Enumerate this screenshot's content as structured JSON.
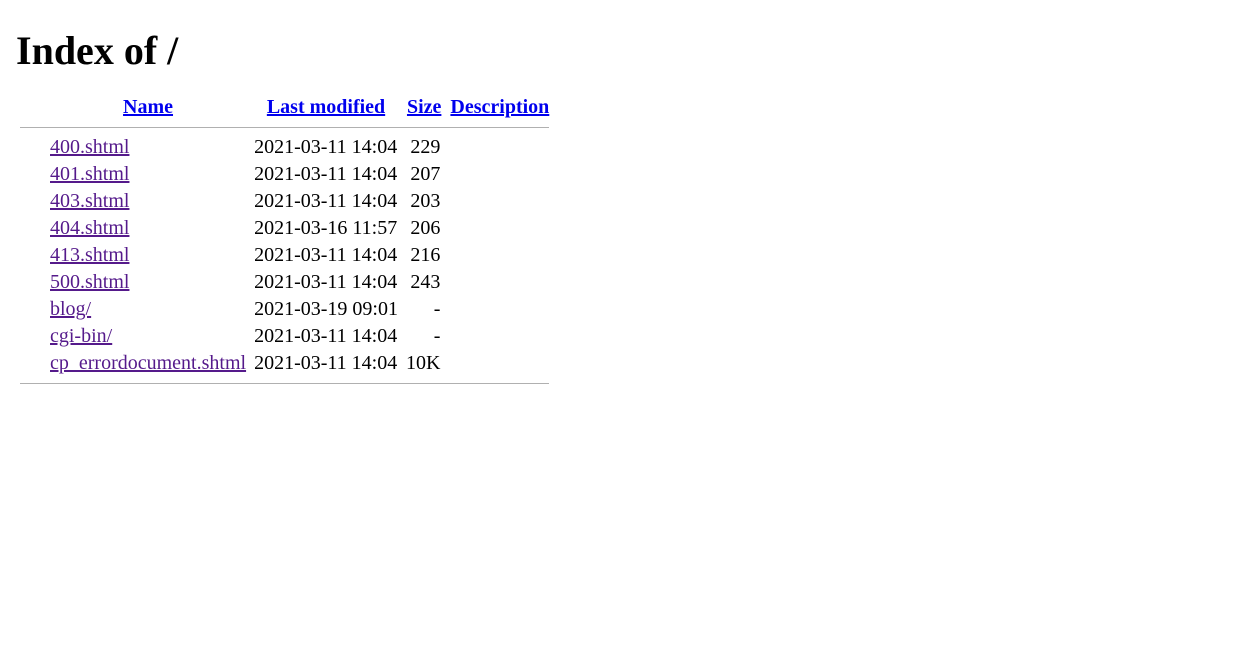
{
  "title": "Index of /",
  "columns": {
    "name": "Name",
    "modified": "Last modified",
    "size": "Size",
    "description": "Description"
  },
  "rows": [
    {
      "name": "400.shtml",
      "modified": "2021-03-11 14:04",
      "size": "229",
      "description": ""
    },
    {
      "name": "401.shtml",
      "modified": "2021-03-11 14:04",
      "size": "207",
      "description": ""
    },
    {
      "name": "403.shtml",
      "modified": "2021-03-11 14:04",
      "size": "203",
      "description": ""
    },
    {
      "name": "404.shtml",
      "modified": "2021-03-16 11:57",
      "size": "206",
      "description": ""
    },
    {
      "name": "413.shtml",
      "modified": "2021-03-11 14:04",
      "size": "216",
      "description": ""
    },
    {
      "name": "500.shtml",
      "modified": "2021-03-11 14:04",
      "size": "243",
      "description": ""
    },
    {
      "name": "blog/",
      "modified": "2021-03-19 09:01",
      "size": "-",
      "description": ""
    },
    {
      "name": "cgi-bin/",
      "modified": "2021-03-11 14:04",
      "size": "-",
      "description": ""
    },
    {
      "name": "cp_errordocument.shtml",
      "modified": "2021-03-11 14:04",
      "size": "10K",
      "description": ""
    }
  ]
}
